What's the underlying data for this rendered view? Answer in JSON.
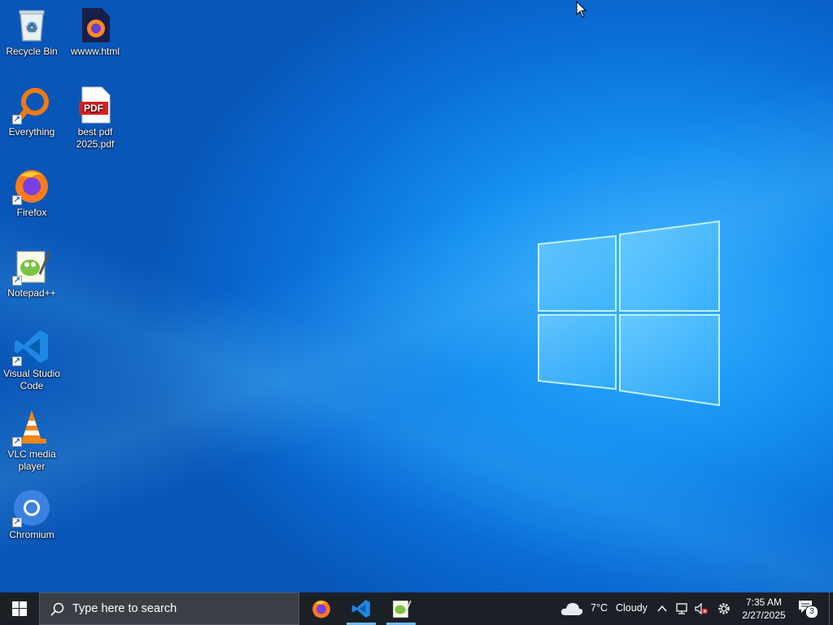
{
  "desktop": {
    "icons": [
      {
        "label": "Recycle Bin"
      },
      {
        "label": "wwww.html"
      },
      {
        "label": "Everything"
      },
      {
        "label": "best pdf 2025.pdf"
      },
      {
        "label": "Firefox"
      },
      {
        "label": "Notepad++"
      },
      {
        "label": "Visual Studio Code"
      },
      {
        "label": "VLC media player"
      },
      {
        "label": "Chromium"
      }
    ]
  },
  "taskbar": {
    "search_placeholder": "Type here to search",
    "pinned": [
      "firefox-icon",
      "vscode-icon",
      "notepadpp-icon"
    ],
    "weather": {
      "temp": "7°C",
      "condition": "Cloudy"
    },
    "time": "7:35 AM",
    "date": "2/27/2025",
    "notification_count": "3"
  },
  "colors": {
    "taskbar": "#1b2027",
    "accent": "#76b9ed",
    "wallpaper": "#0a6fd8"
  }
}
